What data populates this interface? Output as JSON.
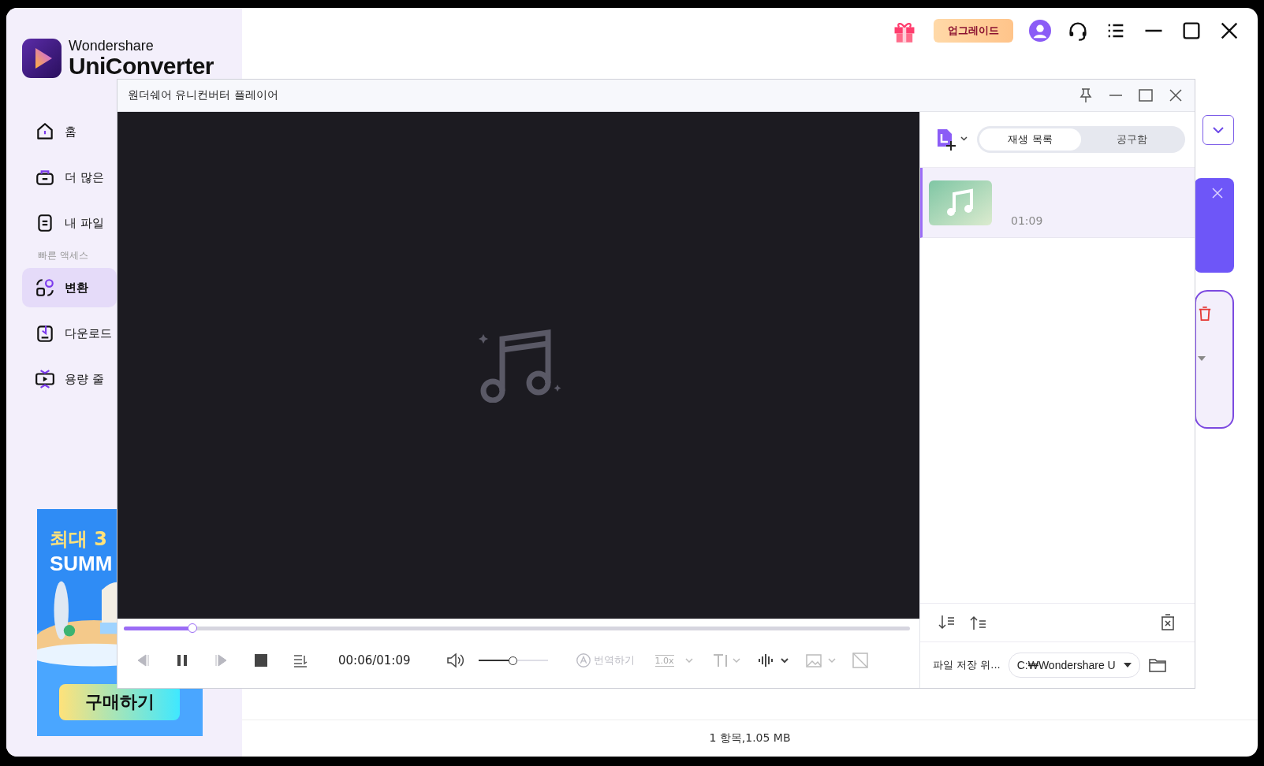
{
  "app": {
    "brand_top": "Wondershare",
    "brand_name": "UniConverter"
  },
  "topbar": {
    "upgrade": "업그레이드"
  },
  "sidebar": {
    "items": [
      {
        "label": "홈",
        "selected": false
      },
      {
        "label": "더 많은",
        "selected": false
      },
      {
        "label": "내 파일",
        "selected": false
      }
    ],
    "section_label": "빠른 액세스",
    "quick": [
      {
        "label": "변환",
        "selected": true
      },
      {
        "label": "다운로드",
        "selected": false
      },
      {
        "label": "용량 줄",
        "selected": false
      }
    ]
  },
  "ad": {
    "lines": [
      "최대 3",
      "SUMM"
    ],
    "button": "구매하기"
  },
  "status_bar": "1 항목,1.05 MB",
  "player": {
    "title": "원더쉐어 유니컨버터 플레이어",
    "progress": {
      "level": 0.087
    },
    "playing": true,
    "time": "00:06/01:09",
    "volume": {
      "level": 0.49
    },
    "translate": {
      "label": "번역하기",
      "disabled": true
    },
    "speed": "1.0x",
    "tabs": [
      {
        "label": "재생 목록",
        "selected": true
      },
      {
        "label": "공구함",
        "selected": false
      }
    ],
    "playlist": [
      {
        "duration": "01:09",
        "selected": true
      }
    ],
    "save": {
      "label": "파일 저장 위...",
      "path": "C:₩Wondershare U"
    }
  }
}
